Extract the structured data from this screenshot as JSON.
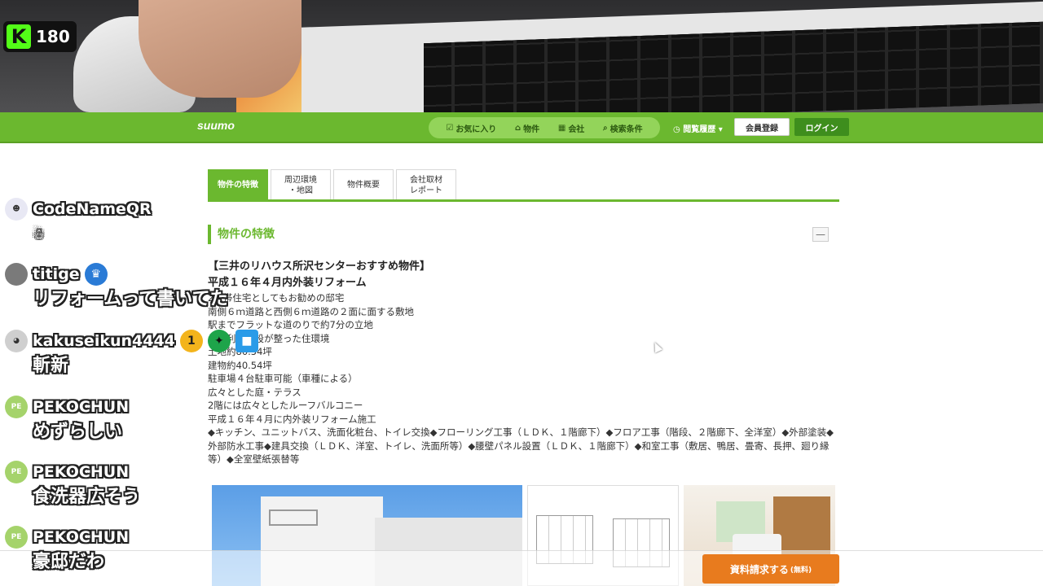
{
  "stream": {
    "viewer_count": "180",
    "platform_icon": "kick-logo-icon"
  },
  "header": {
    "logo": "suumo",
    "nav": [
      {
        "label": "お気に入り",
        "icon": "checkbox-icon"
      },
      {
        "label": "物件",
        "icon": "home-icon"
      },
      {
        "label": "会社",
        "icon": "building-icon"
      },
      {
        "label": "検索条件",
        "icon": "search-icon"
      }
    ],
    "history": "閲覧履歴",
    "register": "会員登録",
    "login": "ログイン"
  },
  "tabs": [
    {
      "label": "物件の特徴",
      "active": true
    },
    {
      "label": "周辺環境\n・地図",
      "active": false
    },
    {
      "label": "物件概要",
      "active": false
    },
    {
      "label": "会社取材\nレポート",
      "active": false
    }
  ],
  "section": {
    "title": "物件の特徴",
    "heading1": "【三井のリハウス所沢センターおすすめ物件】",
    "heading2": "平成１６年４月内外装リフォーム",
    "lines": [
      "2世帯住宅としてもお勧めの邸宅",
      "南側６ｍ道路と西側６ｍ道路の２面に面する敷地",
      "駅までフラットな道のりで約7分の立地",
      "生活利便施設が整った住環境",
      "土地約80.54坪",
      "建物約40.54坪",
      "駐車場４台駐車可能（車種による）",
      "広々とした庭・テラス",
      "2階には広々としたルーフバルコニー",
      "平成１６年４月に内外装リフォーム施工",
      "◆キッチン、ユニットバス、洗面化粧台、トイレ交換◆フローリング工事（ＬＤＫ、１階廊下）◆フロア工事（階段、２階廊下、全洋室）◆外部塗装◆外部防水工事◆建具交換（ＬＤＫ、洋室、トイレ、洗面所等）◆腰壁パネル設置（ＬＤＫ、１階廊下）◆和室工事（敷居、鴨居、畳寄、長押、廻り縁等）◆全室壁紙張替等"
    ],
    "collapse": "—"
  },
  "cta": {
    "label": "資料請求する",
    "sub": "(無料)"
  },
  "chat": [
    {
      "user": "CodeNameQR",
      "text": "",
      "avatar_color": "#e8e8f4",
      "avatar_text": "",
      "badges": []
    },
    {
      "user": "titige",
      "text": "リフォームって書いてた",
      "avatar_color": "#7a7a7a",
      "avatar_text": "",
      "badges": [
        {
          "icon": "crown-badge-icon",
          "color": "#2a7bd6",
          "glyph": "♛"
        }
      ]
    },
    {
      "user": "kakuseikun4444",
      "text": "斬新",
      "avatar_color": "#cfcfcf",
      "avatar_text": "",
      "badges": [
        {
          "icon": "one-month-badge-icon",
          "color": "#f3b41c",
          "glyph": "1"
        },
        {
          "icon": "star-badge-icon",
          "color": "#1ea44a",
          "glyph": "✦"
        },
        {
          "icon": "cube-badge-icon",
          "color": "#2a9be8",
          "glyph": "■"
        }
      ]
    },
    {
      "user": "PEKOCHUN",
      "text": "めずらしい",
      "avatar_color": "#a5d36b",
      "avatar_text": "PE",
      "badges": []
    },
    {
      "user": "PEKOCHUN",
      "text": "食洗器広そう",
      "avatar_color": "#a5d36b",
      "avatar_text": "PE",
      "badges": []
    },
    {
      "user": "PEKOCHUN",
      "text": "豪邸だわ",
      "avatar_color": "#a5d36b",
      "avatar_text": "PE",
      "badges": []
    }
  ]
}
